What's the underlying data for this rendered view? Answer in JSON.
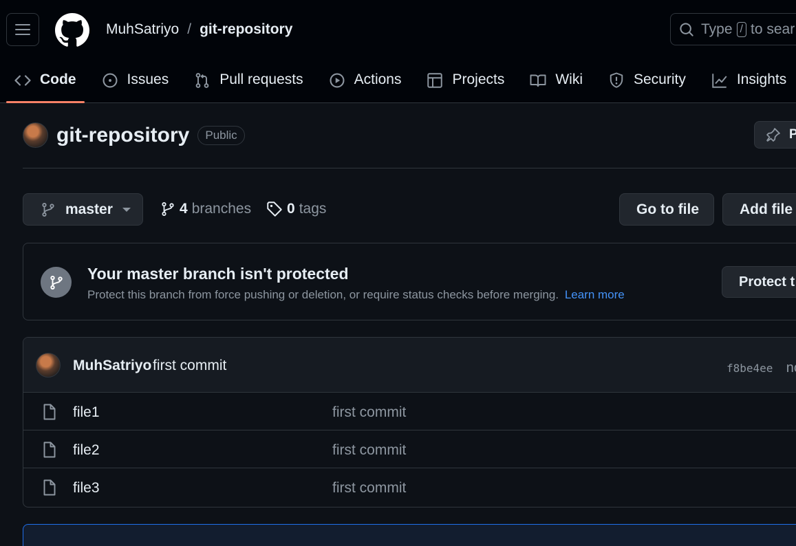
{
  "header": {
    "owner": "MuhSatriyo",
    "separator": "/",
    "repo": "git-repository",
    "search_prefix": "Type",
    "search_key": "/",
    "search_suffix": "to sear"
  },
  "nav": {
    "tabs": [
      {
        "label": "Code",
        "icon": "code-icon",
        "active": true
      },
      {
        "label": "Issues",
        "icon": "issue-icon"
      },
      {
        "label": "Pull requests",
        "icon": "pull-request-icon"
      },
      {
        "label": "Actions",
        "icon": "play-icon"
      },
      {
        "label": "Projects",
        "icon": "table-icon"
      },
      {
        "label": "Wiki",
        "icon": "book-icon"
      },
      {
        "label": "Security",
        "icon": "shield-icon"
      },
      {
        "label": "Insights",
        "icon": "graph-icon"
      }
    ]
  },
  "repo": {
    "title": "git-repository",
    "visibility": "Public",
    "pin_label": "P"
  },
  "toolbar": {
    "branch": "master",
    "branches_count": "4",
    "branches_label": "branches",
    "tags_count": "0",
    "tags_label": "tags",
    "go_to_file": "Go to file",
    "add_file": "Add file"
  },
  "protection": {
    "title": "Your master branch isn't protected",
    "description": "Protect this branch from force pushing or deletion, or require status checks before merging.",
    "learn_more": "Learn more",
    "button": "Protect t"
  },
  "latest_commit": {
    "author": "MuhSatriyo",
    "message": "first commit",
    "sha": "f8be4ee",
    "time": "nc"
  },
  "files": [
    {
      "name": "file1",
      "commit": "first commit"
    },
    {
      "name": "file2",
      "commit": "first commit"
    },
    {
      "name": "file3",
      "commit": "first commit"
    }
  ],
  "colors": {
    "background": "#0d1117",
    "header": "#010409",
    "accent_underline": "#f78166",
    "link": "#4493f8"
  }
}
